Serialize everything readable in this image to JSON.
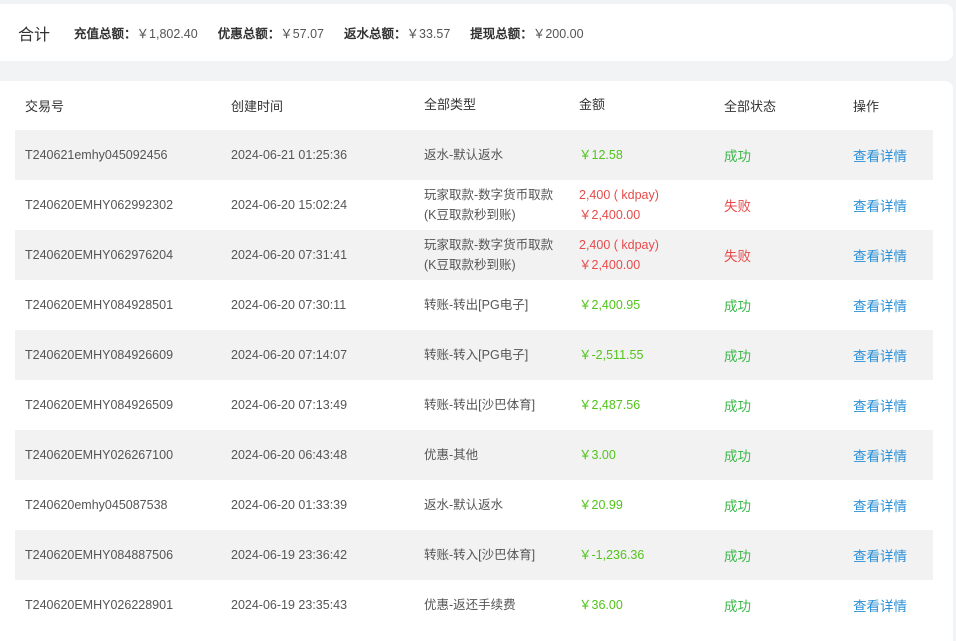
{
  "summary": {
    "title": "合计",
    "items": [
      {
        "label": "充值总额：",
        "value": "￥1,802.40"
      },
      {
        "label": "优惠总额：",
        "value": "￥57.07"
      },
      {
        "label": "返水总额：",
        "value": "￥33.57"
      },
      {
        "label": "提现总额：",
        "value": "￥200.00"
      }
    ]
  },
  "table": {
    "headers": [
      "交易号",
      "创建时间",
      "全部类型",
      "金额",
      "全部状态",
      "操作"
    ],
    "rows": [
      {
        "id": "T240621emhy045092456",
        "time": "2024-06-21 01:25:36",
        "type1": "返水-默认返水",
        "type2": "",
        "amount1": "￥12.58",
        "amount2": "",
        "status": "成功",
        "action": "查看详情"
      },
      {
        "id": "T240620EMHY062992302",
        "time": "2024-06-20 15:02:24",
        "type1": "玩家取款-数字货币取款",
        "type2": "(K豆取款秒到账)",
        "amount1": "2,400 ( kdpay)",
        "amount2": "￥2,400.00",
        "status": "失败",
        "action": "查看详情"
      },
      {
        "id": "T240620EMHY062976204",
        "time": "2024-06-20 07:31:41",
        "type1": "玩家取款-数字货币取款",
        "type2": "(K豆取款秒到账)",
        "amount1": "2,400 ( kdpay)",
        "amount2": "￥2,400.00",
        "status": "失败",
        "action": "查看详情"
      },
      {
        "id": "T240620EMHY084928501",
        "time": "2024-06-20 07:30:11",
        "type1": "转账-转出[PG电子]",
        "type2": "",
        "amount1": "￥2,400.95",
        "amount2": "",
        "status": "成功",
        "action": "查看详情"
      },
      {
        "id": "T240620EMHY084926609",
        "time": "2024-06-20 07:14:07",
        "type1": "转账-转入[PG电子]",
        "type2": "",
        "amount1": "￥-2,511.55",
        "amount2": "",
        "status": "成功",
        "action": "查看详情"
      },
      {
        "id": "T240620EMHY084926509",
        "time": "2024-06-20 07:13:49",
        "type1": "转账-转出[沙巴体育]",
        "type2": "",
        "amount1": "￥2,487.56",
        "amount2": "",
        "status": "成功",
        "action": "查看详情"
      },
      {
        "id": "T240620EMHY026267100",
        "time": "2024-06-20 06:43:48",
        "type1": "优惠-其他",
        "type2": "",
        "amount1": "￥3.00",
        "amount2": "",
        "status": "成功",
        "action": "查看详情"
      },
      {
        "id": "T240620emhy045087538",
        "time": "2024-06-20 01:33:39",
        "type1": "返水-默认返水",
        "type2": "",
        "amount1": "￥20.99",
        "amount2": "",
        "status": "成功",
        "action": "查看详情"
      },
      {
        "id": "T240620EMHY084887506",
        "time": "2024-06-19 23:36:42",
        "type1": "转账-转入[沙巴体育]",
        "type2": "",
        "amount1": "￥-1,236.36",
        "amount2": "",
        "status": "成功",
        "action": "查看详情"
      },
      {
        "id": "T240620EMHY026228901",
        "time": "2024-06-19 23:35:43",
        "type1": "优惠-返还手续费",
        "type2": "",
        "amount1": "￥36.00",
        "amount2": "",
        "status": "成功",
        "action": "查看详情"
      }
    ]
  },
  "colors": {
    "success": "#3cb94a",
    "fail": "#e84a4a",
    "link": "#2a8fd6",
    "stripe": "#f2f2f2"
  }
}
